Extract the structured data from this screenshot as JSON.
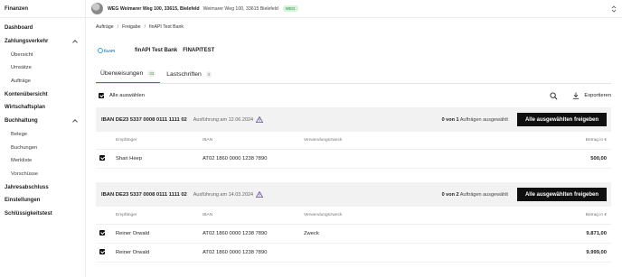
{
  "sidebar": {
    "brand": "Finanzen",
    "items": {
      "dashboard": "Dashboard",
      "zahlungsverkehr": "Zahlungsverkehr",
      "uebersicht": "Übersicht",
      "umsaetze": "Umsätze",
      "auftraege": "Aufträge",
      "kontenuebersicht": "Kontenübersicht",
      "wirtschaftsplan": "Wirtschaftsplan",
      "buchhaltung": "Buchhaltung",
      "belege": "Belege",
      "buchungen": "Buchungen",
      "merkliste": "Merkliste",
      "vorschuesse": "Vorschüsse",
      "jahresabschluss": "Jahresabschluss",
      "einstellungen": "Einstellungen",
      "schluesselkeitstest": "Schlüssigkeitstest"
    }
  },
  "topbar": {
    "property_name": "WEG Weimarer Weg 100, 33615, Bielefeld",
    "property_address": "Weimarer Weg 100, 33615 Bielefeld",
    "badge": "WEG",
    "badge_color": "#d7f2dd"
  },
  "breadcrumb": [
    "Aufträge",
    "Freigabe",
    "finAPI Test Bank"
  ],
  "bank": {
    "logo_text": "finAPI",
    "name": "finAPI Test Bank",
    "code": "FINAPITEST"
  },
  "tabs": [
    {
      "label": "Überweisungen",
      "count": "33",
      "active": true
    },
    {
      "label": "Lastschriften",
      "count": "0",
      "active": false
    }
  ],
  "toolbar": {
    "select_all_label": "Alle auswählen",
    "export_label": "Exportieren"
  },
  "columns": {
    "receiver": "Empfänger",
    "iban": "IBAN",
    "purpose": "Verwendungszweck",
    "amount": "Betrag in €"
  },
  "groups": [
    {
      "iban_title": "IBAN DE23 5337 0008 0111 1111 02",
      "execution": "Ausführung am 12.06.2024",
      "selected_prefix": "0 von 1",
      "selected_suffix": "Aufträgen ausgewählt",
      "button": "Alle ausgewählten freigeben",
      "rows": [
        {
          "receiver": "Shari Heep",
          "iban": "AT02 1860 0000 1238 7890",
          "purpose": "",
          "amount": "500,00"
        }
      ]
    },
    {
      "iban_title": "IBAN DE23 5337 0008 0111 1111 02",
      "execution": "Ausführung am 14.03.2024",
      "selected_prefix": "0 von 2",
      "selected_suffix": "Aufträgen ausgewählt",
      "button": "Alle ausgewählten freigeben",
      "rows": [
        {
          "receiver": "Reiner Orwald",
          "iban": "AT02 1860 0000 1238 7890",
          "purpose": "Zweck",
          "amount": "9.871,00"
        },
        {
          "receiver": "Reiner Orwald",
          "iban": "AT02 1860 0000 1238 7890",
          "purpose": "",
          "amount": "9.999,00"
        }
      ]
    }
  ],
  "colors": {
    "accent_green": "#2d8b4a",
    "warning": "#6b4fa0",
    "button_bg": "#0f0f0f"
  }
}
